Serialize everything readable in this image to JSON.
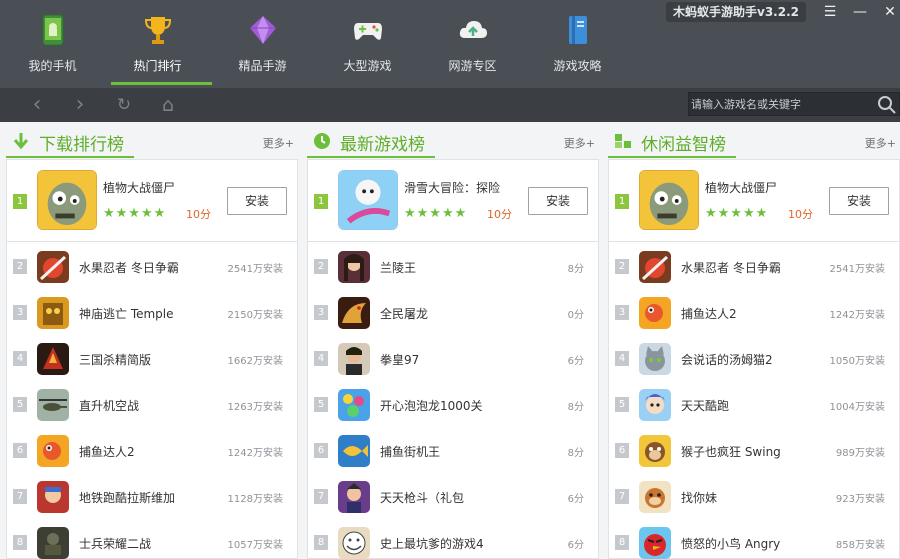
{
  "app": {
    "version": "木蚂蚁手游助手v3.2.2",
    "window_buttons": [
      "☰",
      "—",
      "✕"
    ]
  },
  "nav": [
    {
      "label": "我的手机",
      "icon": "android-phone-icon",
      "active": false
    },
    {
      "label": "热门排行",
      "icon": "trophy-icon",
      "active": true
    },
    {
      "label": "精品手游",
      "icon": "diamond-icon",
      "active": false
    },
    {
      "label": "大型游戏",
      "icon": "gamepad-icon",
      "active": false
    },
    {
      "label": "网游专区",
      "icon": "cloud-icon",
      "active": false
    },
    {
      "label": "游戏攻略",
      "icon": "book-icon",
      "active": false
    }
  ],
  "toolbar": {
    "back": "‹",
    "forward": "›",
    "refresh": "↻",
    "home": "⌂"
  },
  "search": {
    "placeholder": "请输入游戏名或关键字",
    "value": ""
  },
  "colors": {
    "accent_green": "#6cbf3a",
    "header_bg": "#4a4f55",
    "score_orange": "#e0662d"
  },
  "columns": [
    {
      "title": "下载排行榜",
      "icon": "download-arrow-icon",
      "more": "更多+",
      "featured": {
        "rank": "1",
        "name": "植物大战僵尸",
        "stars": "★★★★★",
        "score": "10分",
        "install": "安装",
        "icon": "zombie-icon"
      },
      "rows": [
        {
          "rank": "2",
          "name": "水果忍者 冬日争霸",
          "meta": "2541万安装",
          "icon": "fruit-ninja-icon"
        },
        {
          "rank": "3",
          "name": "神庙逃亡 Temple",
          "meta": "2150万安装",
          "icon": "temple-run-icon"
        },
        {
          "rank": "4",
          "name": "三国杀精简版",
          "meta": "1662万安装",
          "icon": "three-kingdoms-icon"
        },
        {
          "rank": "5",
          "name": "直升机空战",
          "meta": "1263万安装",
          "icon": "helicopter-icon"
        },
        {
          "rank": "6",
          "name": "捕鱼达人2",
          "meta": "1242万安装",
          "icon": "fishing-icon"
        },
        {
          "rank": "7",
          "name": "地铁跑酷拉斯维加",
          "meta": "1128万安装",
          "icon": "subway-surfers-icon"
        },
        {
          "rank": "8",
          "name": "士兵荣耀二战",
          "meta": "1057万安装",
          "icon": "soldier-icon"
        }
      ]
    },
    {
      "title": "最新游戏榜",
      "icon": "clock-icon",
      "more": "更多+",
      "featured": {
        "rank": "1",
        "name": "滑雪大冒险：探险",
        "stars": "★★★★★",
        "score": "10分",
        "install": "安装",
        "icon": "ski-adventure-icon"
      },
      "rows": [
        {
          "rank": "2",
          "name": "兰陵王",
          "meta": "8分",
          "icon": "lanling-icon"
        },
        {
          "rank": "3",
          "name": "全民屠龙",
          "meta": "0分",
          "icon": "dragon-icon"
        },
        {
          "rank": "4",
          "name": "拳皇97",
          "meta": "6分",
          "icon": "kof-icon"
        },
        {
          "rank": "5",
          "name": "开心泡泡龙1000关",
          "meta": "8分",
          "icon": "bubble-icon"
        },
        {
          "rank": "6",
          "name": "捕鱼街机王",
          "meta": "8分",
          "icon": "fishing-arcade-icon"
        },
        {
          "rank": "7",
          "name": "天天枪斗（礼包",
          "meta": "6分",
          "icon": "gunfight-icon"
        },
        {
          "rank": "8",
          "name": "史上最坑爹的游戏4",
          "meta": "6分",
          "icon": "troll-face-icon"
        }
      ]
    },
    {
      "title": "休闲益智榜",
      "icon": "puzzle-blocks-icon",
      "more": "更多+",
      "featured": {
        "rank": "1",
        "name": "植物大战僵尸",
        "stars": "★★★★★",
        "score": "10分",
        "install": "安装",
        "icon": "zombie-icon"
      },
      "rows": [
        {
          "rank": "2",
          "name": "水果忍者 冬日争霸",
          "meta": "2541万安装",
          "icon": "fruit-ninja-icon"
        },
        {
          "rank": "3",
          "name": "捕鱼达人2",
          "meta": "1242万安装",
          "icon": "fishing-icon"
        },
        {
          "rank": "4",
          "name": "会说话的汤姆猫2",
          "meta": "1050万安装",
          "icon": "talking-tom-icon"
        },
        {
          "rank": "5",
          "name": "天天酷跑",
          "meta": "1004万安装",
          "icon": "parkour-icon"
        },
        {
          "rank": "6",
          "name": "猴子也疯狂 Swing",
          "meta": "989万安装",
          "icon": "monkey-icon"
        },
        {
          "rank": "7",
          "name": "找你妹",
          "meta": "923万安装",
          "icon": "find-it-icon"
        },
        {
          "rank": "8",
          "name": "愤怒的小鸟 Angry",
          "meta": "858万安装",
          "icon": "angry-birds-icon"
        }
      ]
    }
  ]
}
